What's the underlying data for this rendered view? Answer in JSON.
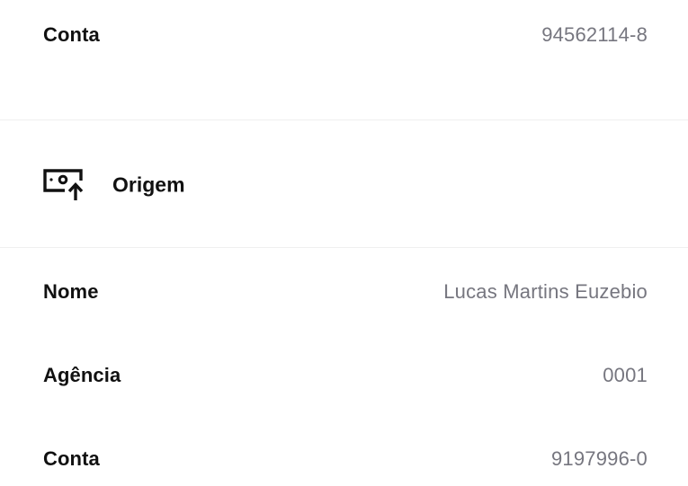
{
  "destination": {
    "conta_label": "Conta",
    "conta_value": "94562114-8"
  },
  "origem": {
    "title": "Origem",
    "icon": "money-upload-icon",
    "nome_label": "Nome",
    "nome_value": "Lucas Martins Euzebio",
    "agencia_label": "Agência",
    "agencia_value": "0001",
    "conta_label": "Conta",
    "conta_value": "9197996-0"
  }
}
